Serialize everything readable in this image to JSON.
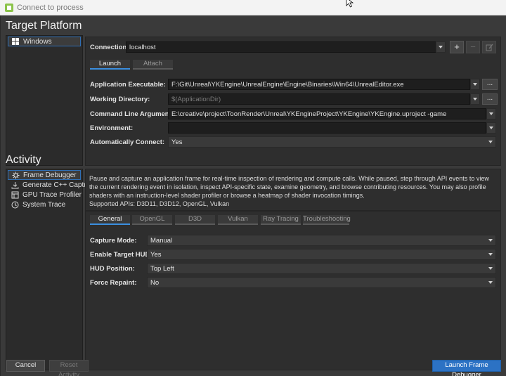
{
  "window": {
    "title": "Connect to process"
  },
  "target_platform": {
    "heading": "Target Platform",
    "platforms": [
      {
        "label": "Windows",
        "icon": "windows-logo-icon",
        "selected": true
      }
    ],
    "connection_label": "Connection:",
    "connection_value": "localhost",
    "tabs": [
      {
        "label": "Launch",
        "active": true
      },
      {
        "label": "Attach",
        "active": false
      }
    ],
    "fields": {
      "app_exe_label": "Application Executable:",
      "app_exe_value": "F:\\Git\\Unreal\\YKEngine\\UnrealEngine\\Engine\\Binaries\\Win64\\UnrealEditor.exe",
      "working_dir_label": "Working Directory:",
      "working_dir_placeholder": "$(ApplicationDir)",
      "cmd_args_label": "Command Line Arguments:",
      "cmd_args_value": "E:\\creative\\project\\ToonRender\\Unreal\\YKEngineProject\\YKEngine\\YKEngine.uproject -game",
      "environment_label": "Environment:",
      "environment_value": "",
      "auto_connect_label": "Automatically Connect:",
      "auto_connect_value": "Yes"
    },
    "ellipsis": "..."
  },
  "activity": {
    "heading": "Activity",
    "items": [
      {
        "label": "Frame Debugger",
        "icon": "bug-icon",
        "selected": true
      },
      {
        "label": "Generate C++ Capture",
        "icon": "download-icon",
        "selected": false
      },
      {
        "label": "GPU Trace Profiler",
        "icon": "trace-icon",
        "selected": false
      },
      {
        "label": "System Trace",
        "icon": "clock-icon",
        "selected": false
      }
    ],
    "description": "Pause and capture an application frame for real-time inspection of rendering and compute calls. While paused, step through API events to view the current rendering event in isolation, inspect API-specific state, examine geometry, and browse contributing resources. You may also profile shaders with an instruction-level shader profiler or browse a heatmap of shader invocation timings.",
    "supported_apis": "Supported APIs: D3D11, D3D12, OpenGL, Vulkan",
    "tabs": [
      {
        "label": "General",
        "active": true
      },
      {
        "label": "OpenGL",
        "active": false
      },
      {
        "label": "D3D",
        "active": false
      },
      {
        "label": "Vulkan",
        "active": false
      },
      {
        "label": "Ray Tracing",
        "active": false
      },
      {
        "label": "Troubleshooting",
        "active": false
      }
    ],
    "settings": {
      "capture_mode_label": "Capture Mode:",
      "capture_mode_value": "Manual",
      "enable_hud_label": "Enable Target HUD:",
      "enable_hud_value": "Yes",
      "hud_position_label": "HUD Position:",
      "hud_position_value": "Top Left",
      "force_repaint_label": "Force Repaint:",
      "force_repaint_value": "No"
    }
  },
  "footer": {
    "cancel_label": "Cancel",
    "reset_label": "Reset Activity",
    "launch_label": "Launch Frame Debugger"
  },
  "colors": {
    "accent": "#2c72c4",
    "tab_active_underline": "#3b8fe0",
    "background": "#3a3a3a"
  }
}
